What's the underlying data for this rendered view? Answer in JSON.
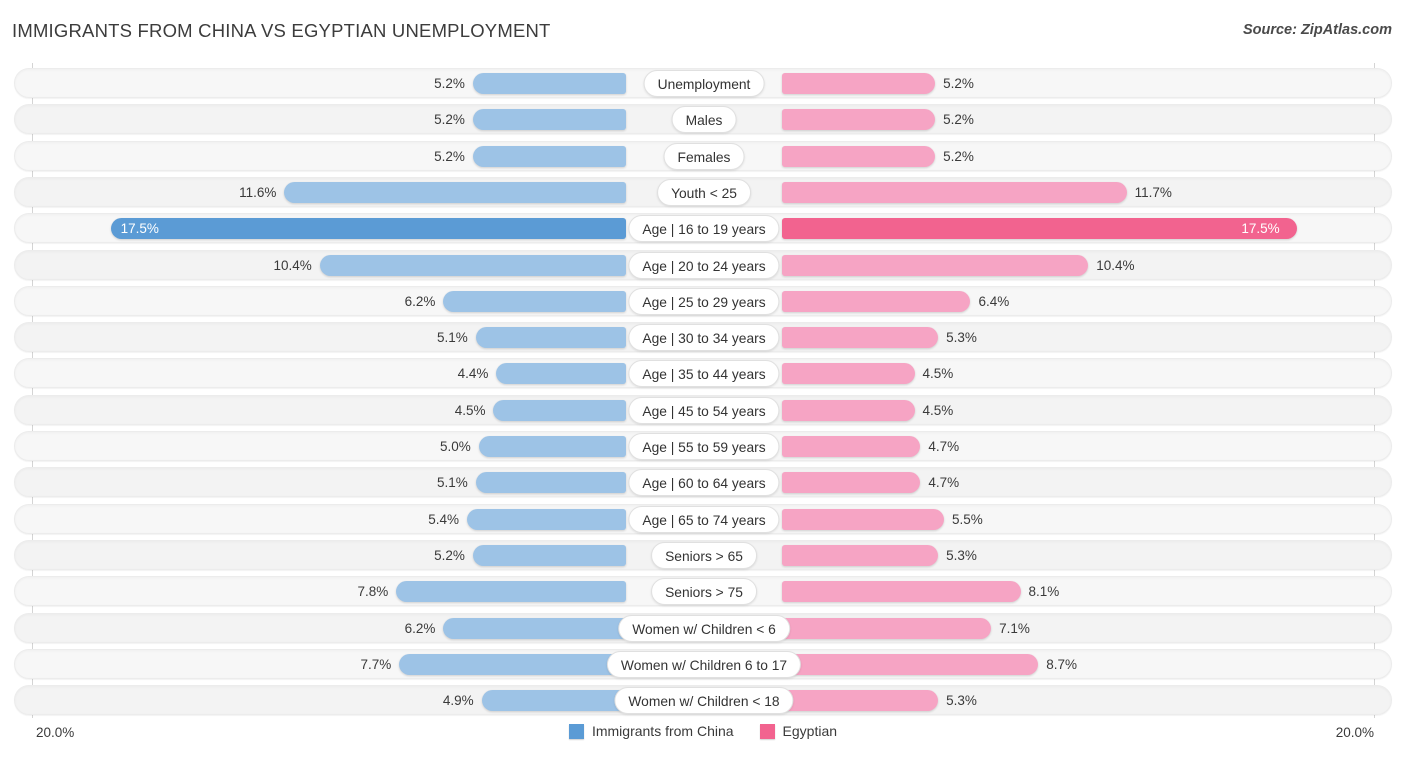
{
  "header": {
    "title": "IMMIGRANTS FROM CHINA VS EGYPTIAN UNEMPLOYMENT",
    "source": "Source: ZipAtlas.com"
  },
  "axis": {
    "left_max_label": "20.0%",
    "right_max_label": "20.0%",
    "max_value": 20.0
  },
  "legend": {
    "items": [
      {
        "label": "Immigrants from China",
        "color": "#5b9bd5",
        "name": "legend-immigrants-from-china"
      },
      {
        "label": "Egyptian",
        "color": "#f2638f",
        "name": "legend-egyptian"
      }
    ]
  },
  "colors": {
    "left_bar": "#9dc3e6",
    "left_bar_highlight": "#5b9bd5",
    "right_bar": "#f6a4c4",
    "right_bar_highlight": "#f2638f",
    "track": "#f7f7f7",
    "track_alt": "#f3f3f3"
  },
  "chart_data": {
    "type": "bar",
    "subtype": "diverging-butterfly",
    "title": "IMMIGRANTS FROM CHINA VS EGYPTIAN UNEMPLOYMENT",
    "xlabel": "",
    "ylabel": "",
    "xlim": [
      20.0,
      20.0
    ],
    "grid": false,
    "legend_position": "bottom-center",
    "categories": [
      "Unemployment",
      "Males",
      "Females",
      "Youth < 25",
      "Age | 16 to 19 years",
      "Age | 20 to 24 years",
      "Age | 25 to 29 years",
      "Age | 30 to 34 years",
      "Age | 35 to 44 years",
      "Age | 45 to 54 years",
      "Age | 55 to 59 years",
      "Age | 60 to 64 years",
      "Age | 65 to 74 years",
      "Seniors > 65",
      "Seniors > 75",
      "Women w/ Children < 6",
      "Women w/ Children 6 to 17",
      "Women w/ Children < 18"
    ],
    "series": [
      {
        "name": "Immigrants from China",
        "color": "#9dc3e6",
        "values": [
          5.2,
          5.2,
          5.2,
          11.6,
          17.5,
          10.4,
          6.2,
          5.1,
          4.4,
          4.5,
          5.0,
          5.1,
          5.4,
          5.2,
          7.8,
          6.2,
          7.7,
          4.9
        ],
        "labels": [
          "5.2%",
          "5.2%",
          "5.2%",
          "11.6%",
          "17.5%",
          "10.4%",
          "6.2%",
          "5.1%",
          "4.4%",
          "4.5%",
          "5.0%",
          "5.1%",
          "5.4%",
          "5.2%",
          "7.8%",
          "6.2%",
          "7.7%",
          "4.9%"
        ]
      },
      {
        "name": "Egyptian",
        "color": "#f6a4c4",
        "values": [
          5.2,
          5.2,
          5.2,
          11.7,
          17.5,
          10.4,
          6.4,
          5.3,
          4.5,
          4.5,
          4.7,
          4.7,
          5.5,
          5.3,
          8.1,
          7.1,
          8.7,
          5.3
        ],
        "labels": [
          "5.2%",
          "5.2%",
          "5.2%",
          "11.7%",
          "17.5%",
          "10.4%",
          "6.4%",
          "5.3%",
          "4.5%",
          "4.5%",
          "4.7%",
          "4.7%",
          "5.5%",
          "5.3%",
          "8.1%",
          "7.1%",
          "8.7%",
          "5.3%"
        ]
      }
    ],
    "highlight_row_index": 4
  },
  "rows": [
    {
      "label": "Unemployment",
      "left": "5.2%",
      "right": "5.2%",
      "lv": 5.2,
      "rv": 5.2
    },
    {
      "label": "Males",
      "left": "5.2%",
      "right": "5.2%",
      "lv": 5.2,
      "rv": 5.2
    },
    {
      "label": "Females",
      "left": "5.2%",
      "right": "5.2%",
      "lv": 5.2,
      "rv": 5.2
    },
    {
      "label": "Youth < 25",
      "left": "11.6%",
      "right": "11.7%",
      "lv": 11.6,
      "rv": 11.7
    },
    {
      "label": "Age | 16 to 19 years",
      "left": "17.5%",
      "right": "17.5%",
      "lv": 17.5,
      "rv": 17.5
    },
    {
      "label": "Age | 20 to 24 years",
      "left": "10.4%",
      "right": "10.4%",
      "lv": 10.4,
      "rv": 10.4
    },
    {
      "label": "Age | 25 to 29 years",
      "left": "6.2%",
      "right": "6.4%",
      "lv": 6.2,
      "rv": 6.4
    },
    {
      "label": "Age | 30 to 34 years",
      "left": "5.1%",
      "right": "5.3%",
      "lv": 5.1,
      "rv": 5.3
    },
    {
      "label": "Age | 35 to 44 years",
      "left": "4.4%",
      "right": "4.5%",
      "lv": 4.4,
      "rv": 4.5
    },
    {
      "label": "Age | 45 to 54 years",
      "left": "4.5%",
      "right": "4.5%",
      "lv": 4.5,
      "rv": 4.5
    },
    {
      "label": "Age | 55 to 59 years",
      "left": "5.0%",
      "right": "4.7%",
      "lv": 5.0,
      "rv": 4.7
    },
    {
      "label": "Age | 60 to 64 years",
      "left": "5.1%",
      "right": "4.7%",
      "lv": 5.1,
      "rv": 4.7
    },
    {
      "label": "Age | 65 to 74 years",
      "left": "5.4%",
      "right": "5.5%",
      "lv": 5.4,
      "rv": 5.5
    },
    {
      "label": "Seniors > 65",
      "left": "5.2%",
      "right": "5.3%",
      "lv": 5.2,
      "rv": 5.3
    },
    {
      "label": "Seniors > 75",
      "left": "7.8%",
      "right": "8.1%",
      "lv": 7.8,
      "rv": 8.1
    },
    {
      "label": "Women w/ Children < 6",
      "left": "6.2%",
      "right": "7.1%",
      "lv": 6.2,
      "rv": 7.1
    },
    {
      "label": "Women w/ Children 6 to 17",
      "left": "7.7%",
      "right": "8.7%",
      "lv": 7.7,
      "rv": 8.7
    },
    {
      "label": "Women w/ Children < 18",
      "left": "4.9%",
      "right": "5.3%",
      "lv": 4.9,
      "rv": 5.3
    }
  ]
}
